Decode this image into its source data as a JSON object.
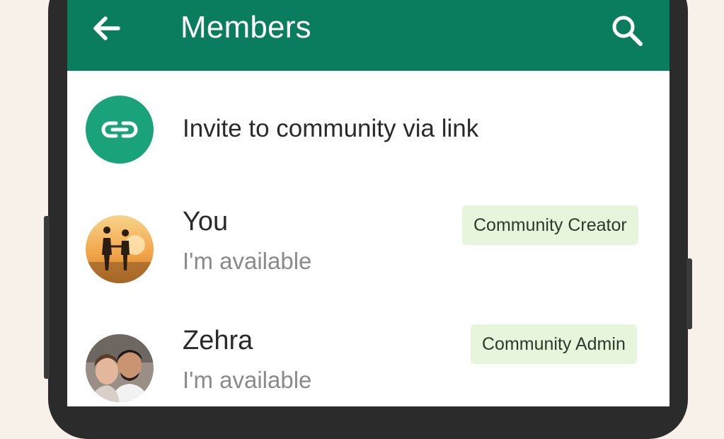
{
  "colors": {
    "brand": "#0a7d5f",
    "accent": "#1aa37a",
    "badge_bg": "#e6f6dd",
    "badge_fg": "#2c3a2c"
  },
  "header": {
    "title": "Members",
    "back_icon": "arrow-left-icon",
    "search_icon": "search-icon"
  },
  "invite": {
    "icon": "link-icon",
    "label": "Invite to community via link"
  },
  "members": [
    {
      "name": "You",
      "status": "I'm available",
      "role": "Community Creator",
      "avatar": "couple-sunset-photo"
    },
    {
      "name": "Zehra",
      "status": "I'm available",
      "role": "Community Admin",
      "avatar": "couple-portrait-photo"
    }
  ]
}
